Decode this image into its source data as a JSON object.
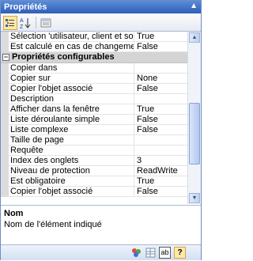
{
  "window": {
    "title": "Propriétés",
    "collapse_icon": "double-chevron-up"
  },
  "toolbar": {
    "buttons": [
      {
        "name": "categorized-view-button",
        "icon": "categorized-icon",
        "active": true
      },
      {
        "name": "alphabetical-view-button",
        "icon": "sort-az-icon",
        "active": false
      },
      {
        "name": "property-pages-button",
        "icon": "property-pages-icon",
        "active": false
      }
    ]
  },
  "grid": {
    "rows": [
      {
        "type": "prop",
        "name": "Sélection 'utilisateur, client et société' ?",
        "value": "True"
      },
      {
        "type": "prop",
        "name": "Est calculé en cas de changement",
        "value": "False"
      },
      {
        "type": "cat",
        "name": "Propriétés configurables",
        "toggle": "−"
      },
      {
        "type": "prop",
        "name": "Copier dans",
        "value": ""
      },
      {
        "type": "prop",
        "name": "Copier sur",
        "value": "None"
      },
      {
        "type": "prop",
        "name": "Copier l'objet associé",
        "value": "False"
      },
      {
        "type": "prop",
        "name": "Description",
        "value": ""
      },
      {
        "type": "prop",
        "name": "Afficher dans la fenêtre",
        "value": "True"
      },
      {
        "type": "prop",
        "name": "Liste déroulante simple",
        "value": "False"
      },
      {
        "type": "prop",
        "name": "Liste complexe",
        "value": "False"
      },
      {
        "type": "prop",
        "name": "Taille de page",
        "value": ""
      },
      {
        "type": "prop",
        "name": "Requête",
        "value": ""
      },
      {
        "type": "prop",
        "name": "Index des onglets",
        "value": "3"
      },
      {
        "type": "prop",
        "name": "Niveau de protection",
        "value": "ReadWrite"
      },
      {
        "type": "prop",
        "name": "Est obligatoire",
        "value": "True"
      },
      {
        "type": "prop",
        "name": "Copier l'objet associé",
        "value": "False"
      }
    ]
  },
  "description": {
    "title": "Nom",
    "text": "Nom de l'élément indiqué"
  },
  "bottom_bar": {
    "icons": [
      {
        "name": "color-palette-icon",
        "active": false
      },
      {
        "name": "grid-view-icon",
        "active": false
      },
      {
        "name": "text-field-icon",
        "label": "ab",
        "active": false
      },
      {
        "name": "help-icon",
        "label": "?",
        "active": true
      }
    ]
  },
  "colors": {
    "title_bar": "#3a6cc4",
    "category_bg": "#d4d4d4",
    "active_button": "#fde8a8"
  }
}
